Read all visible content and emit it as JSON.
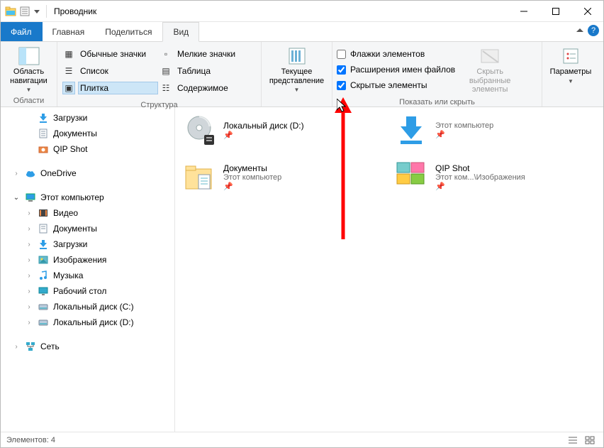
{
  "title": "Проводник",
  "tabs": {
    "file": "Файл",
    "home": "Главная",
    "share": "Поделиться",
    "view": "Вид"
  },
  "ribbon": {
    "panes_group": "Области",
    "nav_pane": "Область навигации",
    "layout_group": "Структура",
    "layouts": {
      "medium_icons": "Обычные значки",
      "small_icons": "Мелкие значки",
      "list": "Список",
      "table": "Таблица",
      "tiles": "Плитка",
      "content": "Содержимое"
    },
    "current_view": "Текущее представление",
    "show_hide_group": "Показать или скрыть",
    "checkboxes": {
      "item_checkboxes": "Флажки элементов",
      "file_ext": "Расширения имен файлов",
      "hidden": "Скрытые элементы"
    },
    "hide_selected": "Скрыть выбранные элементы",
    "options": "Параметры"
  },
  "tree": {
    "downloads": "Загрузки",
    "documents": "Документы",
    "qip": "QIP Shot",
    "onedrive": "OneDrive",
    "thispc": "Этот компьютер",
    "video": "Видео",
    "docs2": "Документы",
    "downloads2": "Загрузки",
    "pictures": "Изображения",
    "music": "Музыка",
    "desktop": "Рабочий стол",
    "diskc": "Локальный диск (C:)",
    "diskd": "Локальный диск (D:)",
    "network": "Сеть"
  },
  "tiles": {
    "t1": {
      "name": "Локальный диск (D:)",
      "sub": ""
    },
    "t2": {
      "name": "",
      "sub": "Этот компьютер"
    },
    "t3": {
      "name": "Документы",
      "sub": "Этот компьютер"
    },
    "t4": {
      "name": "QIP Shot",
      "sub": "Этот ком...\\Изображения"
    }
  },
  "status": {
    "count": "Элементов: 4"
  }
}
